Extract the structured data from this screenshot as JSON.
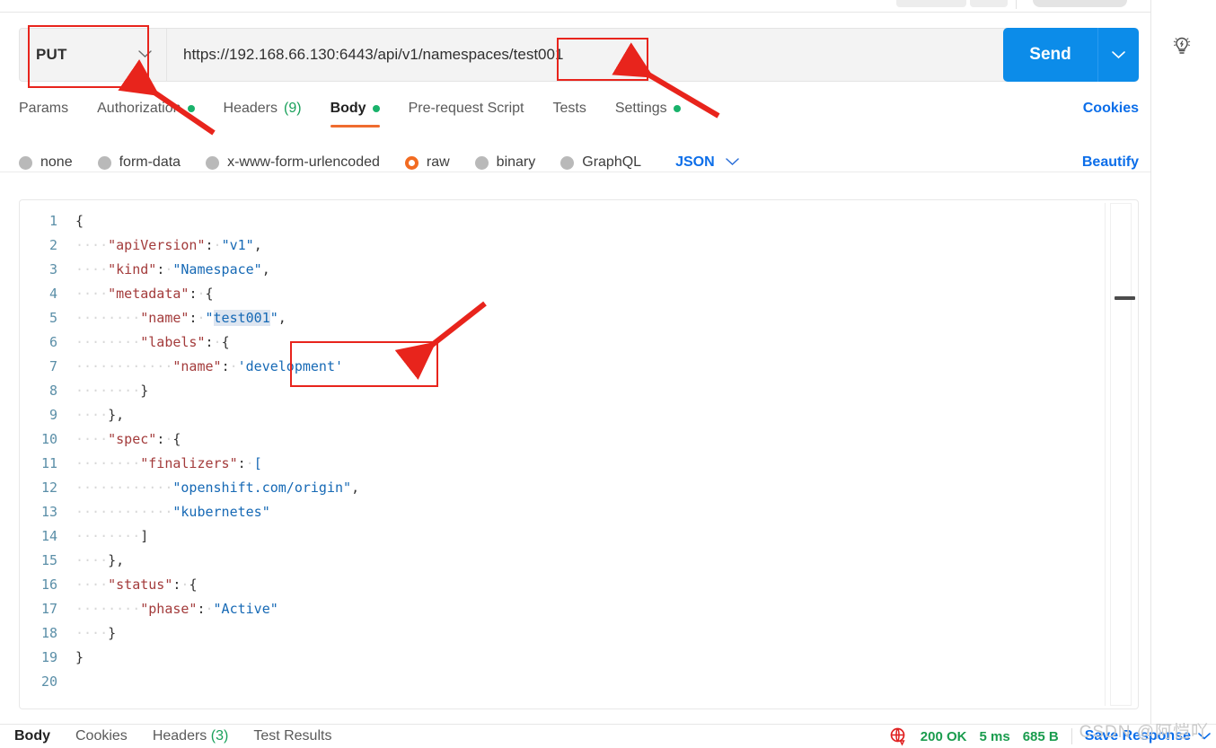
{
  "request": {
    "method": "PUT",
    "url": "https://192.168.66.130:6443/api/v1/namespaces/test001",
    "send_label": "Send",
    "method_caret": "chevron-down",
    "tabs": [
      {
        "label": "Params",
        "active": false,
        "dot": false,
        "count": ""
      },
      {
        "label": "Authorization",
        "active": false,
        "dot": true,
        "count": ""
      },
      {
        "label": "Headers",
        "active": false,
        "dot": false,
        "count": "(9)"
      },
      {
        "label": "Body",
        "active": true,
        "dot": true,
        "count": ""
      },
      {
        "label": "Pre-request Script",
        "active": false,
        "dot": false,
        "count": ""
      },
      {
        "label": "Tests",
        "active": false,
        "dot": false,
        "count": ""
      },
      {
        "label": "Settings",
        "active": false,
        "dot": true,
        "count": ""
      }
    ],
    "cookies_link": "Cookies"
  },
  "body": {
    "modes": [
      {
        "label": "none",
        "selected": false
      },
      {
        "label": "form-data",
        "selected": false
      },
      {
        "label": "x-www-form-urlencoded",
        "selected": false
      },
      {
        "label": "raw",
        "selected": true
      },
      {
        "label": "binary",
        "selected": false
      },
      {
        "label": "GraphQL",
        "selected": false
      }
    ],
    "format": "JSON",
    "beautify_label": "Beautify"
  },
  "editor": {
    "total_lines": 20,
    "lines": [
      {
        "n": "1",
        "tokens": [
          {
            "t": "{",
            "c": "tk-punct"
          }
        ]
      },
      {
        "n": "2",
        "tokens": [
          {
            "t": "····",
            "c": "tk-ws"
          },
          {
            "t": "\"apiVersion\"",
            "c": "tk-key"
          },
          {
            "t": ":",
            "c": "tk-punct"
          },
          {
            "t": "·",
            "c": "tk-ws"
          },
          {
            "t": "\"v1\"",
            "c": "tk-str"
          },
          {
            "t": ",",
            "c": "tk-punct"
          }
        ]
      },
      {
        "n": "3",
        "tokens": [
          {
            "t": "····",
            "c": "tk-ws"
          },
          {
            "t": "\"kind\"",
            "c": "tk-key"
          },
          {
            "t": ":",
            "c": "tk-punct"
          },
          {
            "t": "·",
            "c": "tk-ws"
          },
          {
            "t": "\"Namespace\"",
            "c": "tk-str"
          },
          {
            "t": ",",
            "c": "tk-punct"
          }
        ]
      },
      {
        "n": "4",
        "tokens": [
          {
            "t": "····",
            "c": "tk-ws"
          },
          {
            "t": "\"metadata\"",
            "c": "tk-key"
          },
          {
            "t": ":",
            "c": "tk-punct"
          },
          {
            "t": "·",
            "c": "tk-ws"
          },
          {
            "t": "{",
            "c": "tk-punct"
          }
        ]
      },
      {
        "n": "5",
        "tokens": [
          {
            "t": "····",
            "c": "tk-ws"
          },
          {
            "t": "····",
            "c": "tk-ws"
          },
          {
            "t": "\"name\"",
            "c": "tk-key"
          },
          {
            "t": ":",
            "c": "tk-punct"
          },
          {
            "t": "·",
            "c": "tk-ws"
          },
          {
            "t": "\"",
            "c": "tk-str"
          },
          {
            "t": "test001",
            "c": "tk-str hl"
          },
          {
            "t": "\"",
            "c": "tk-str"
          },
          {
            "t": ",",
            "c": "tk-punct"
          }
        ]
      },
      {
        "n": "6",
        "tokens": [
          {
            "t": "····",
            "c": "tk-ws"
          },
          {
            "t": "····",
            "c": "tk-ws"
          },
          {
            "t": "\"labels\"",
            "c": "tk-key"
          },
          {
            "t": ":",
            "c": "tk-punct"
          },
          {
            "t": "·",
            "c": "tk-ws"
          },
          {
            "t": "{",
            "c": "tk-punct"
          }
        ]
      },
      {
        "n": "7",
        "tokens": [
          {
            "t": "····",
            "c": "tk-ws"
          },
          {
            "t": "····",
            "c": "tk-ws"
          },
          {
            "t": "····",
            "c": "tk-ws"
          },
          {
            "t": "\"name\"",
            "c": "tk-key"
          },
          {
            "t": ":",
            "c": "tk-punct"
          },
          {
            "t": "·",
            "c": "tk-ws"
          },
          {
            "t": "'development'",
            "c": "tk-str"
          }
        ]
      },
      {
        "n": "8",
        "tokens": [
          {
            "t": "····",
            "c": "tk-ws"
          },
          {
            "t": "····",
            "c": "tk-ws"
          },
          {
            "t": "}",
            "c": "tk-punct"
          }
        ]
      },
      {
        "n": "9",
        "tokens": [
          {
            "t": "····",
            "c": "tk-ws"
          },
          {
            "t": "}",
            "c": "tk-punct"
          },
          {
            "t": ",",
            "c": "tk-punct"
          }
        ]
      },
      {
        "n": "10",
        "tokens": [
          {
            "t": "····",
            "c": "tk-ws"
          },
          {
            "t": "\"spec\"",
            "c": "tk-key"
          },
          {
            "t": ":",
            "c": "tk-punct"
          },
          {
            "t": "·",
            "c": "tk-ws"
          },
          {
            "t": "{",
            "c": "tk-punct"
          }
        ]
      },
      {
        "n": "11",
        "tokens": [
          {
            "t": "····",
            "c": "tk-ws"
          },
          {
            "t": "····",
            "c": "tk-ws"
          },
          {
            "t": "\"finalizers\"",
            "c": "tk-key"
          },
          {
            "t": ":",
            "c": "tk-punct"
          },
          {
            "t": "·",
            "c": "tk-ws"
          },
          {
            "t": "[",
            "c": "tk-str"
          }
        ]
      },
      {
        "n": "12",
        "tokens": [
          {
            "t": "····",
            "c": "tk-ws"
          },
          {
            "t": "····",
            "c": "tk-ws"
          },
          {
            "t": "····",
            "c": "tk-ws"
          },
          {
            "t": "\"openshift.com/origin\"",
            "c": "tk-str"
          },
          {
            "t": ",",
            "c": "tk-punct"
          }
        ]
      },
      {
        "n": "13",
        "tokens": [
          {
            "t": "····",
            "c": "tk-ws"
          },
          {
            "t": "····",
            "c": "tk-ws"
          },
          {
            "t": "····",
            "c": "tk-ws"
          },
          {
            "t": "\"kubernetes\"",
            "c": "tk-str"
          }
        ]
      },
      {
        "n": "14",
        "tokens": [
          {
            "t": "····",
            "c": "tk-ws"
          },
          {
            "t": "····",
            "c": "tk-ws"
          },
          {
            "t": "]",
            "c": "tk-punct"
          }
        ]
      },
      {
        "n": "15",
        "tokens": [
          {
            "t": "····",
            "c": "tk-ws"
          },
          {
            "t": "}",
            "c": "tk-punct"
          },
          {
            "t": ",",
            "c": "tk-punct"
          }
        ]
      },
      {
        "n": "16",
        "tokens": [
          {
            "t": "····",
            "c": "tk-ws"
          },
          {
            "t": "\"status\"",
            "c": "tk-key"
          },
          {
            "t": ":",
            "c": "tk-punct"
          },
          {
            "t": "·",
            "c": "tk-ws"
          },
          {
            "t": "{",
            "c": "tk-punct"
          }
        ]
      },
      {
        "n": "17",
        "tokens": [
          {
            "t": "····",
            "c": "tk-ws"
          },
          {
            "t": "····",
            "c": "tk-ws"
          },
          {
            "t": "\"phase\"",
            "c": "tk-key"
          },
          {
            "t": ":",
            "c": "tk-punct"
          },
          {
            "t": "·",
            "c": "tk-ws"
          },
          {
            "t": "\"Active\"",
            "c": "tk-str"
          }
        ]
      },
      {
        "n": "18",
        "tokens": [
          {
            "t": "····",
            "c": "tk-ws"
          },
          {
            "t": "}",
            "c": "tk-punct"
          }
        ]
      },
      {
        "n": "19",
        "tokens": [
          {
            "t": "}",
            "c": "tk-punct"
          }
        ]
      },
      {
        "n": "20",
        "tokens": []
      }
    ]
  },
  "response": {
    "tabs": [
      {
        "label": "Body",
        "active": true,
        "count": ""
      },
      {
        "label": "Cookies",
        "active": false,
        "count": ""
      },
      {
        "label": "Headers",
        "active": false,
        "count": "(3)"
      },
      {
        "label": "Test Results",
        "active": false,
        "count": ""
      }
    ],
    "status": "200 OK",
    "time": "5 ms",
    "size": "685 B",
    "save_response_label": "Save Response"
  },
  "watermark": "CSDN @阿恺吖",
  "colors": {
    "accent_blue": "#0c8ce9",
    "link_blue": "#0c6ee9",
    "active_orange": "#ef6c2f",
    "raw_radio": "#f26b21",
    "status_green": "#1a9c4e",
    "dot_green": "#19b26b",
    "annotation_red": "#e8241c"
  }
}
